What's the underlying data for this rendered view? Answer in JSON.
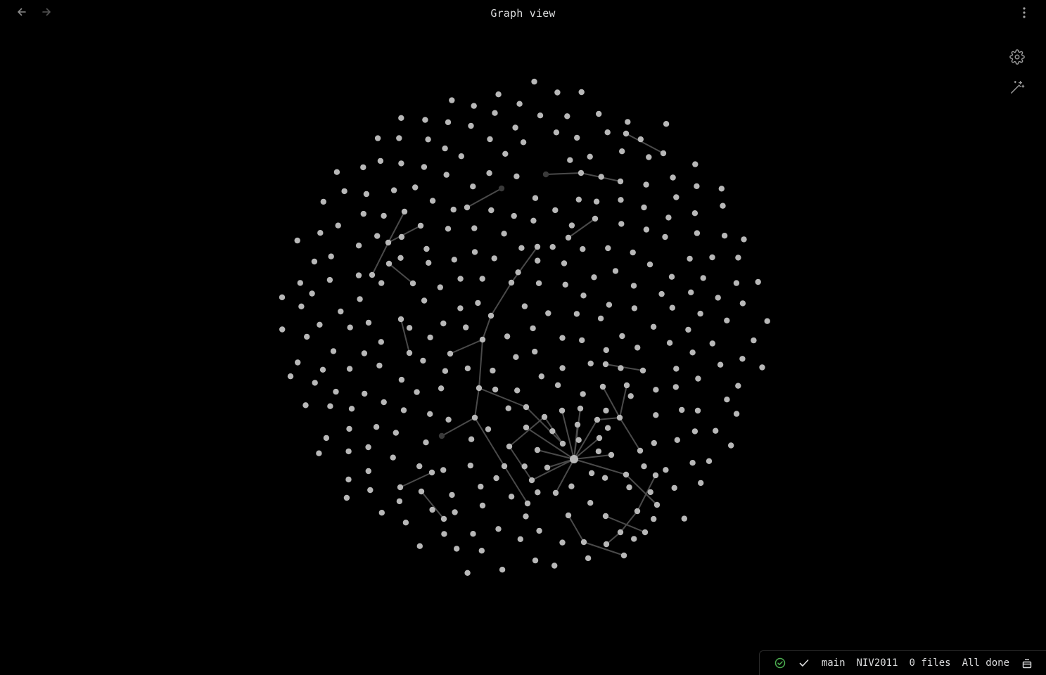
{
  "header": {
    "title": "Graph view",
    "back_icon": "arrow-left-icon",
    "forward_icon": "arrow-right-icon",
    "more_icon": "more-vertical-icon"
  },
  "graph_controls": {
    "settings_icon": "gear-icon",
    "animate_icon": "magic-wand-icon"
  },
  "status_bar": {
    "sync_icon": "circle-check-icon",
    "check_icon": "check-icon",
    "branch": "main",
    "vault": "NIV2011",
    "files": "0 files",
    "status": "All done",
    "layout_icon": "panel-icon"
  },
  "colors": {
    "background": "#000000",
    "node": "#b8b8b8",
    "node_dim": "#3a3a3a",
    "edge": "#4a4a4a",
    "sync_ok": "#4caf50"
  }
}
